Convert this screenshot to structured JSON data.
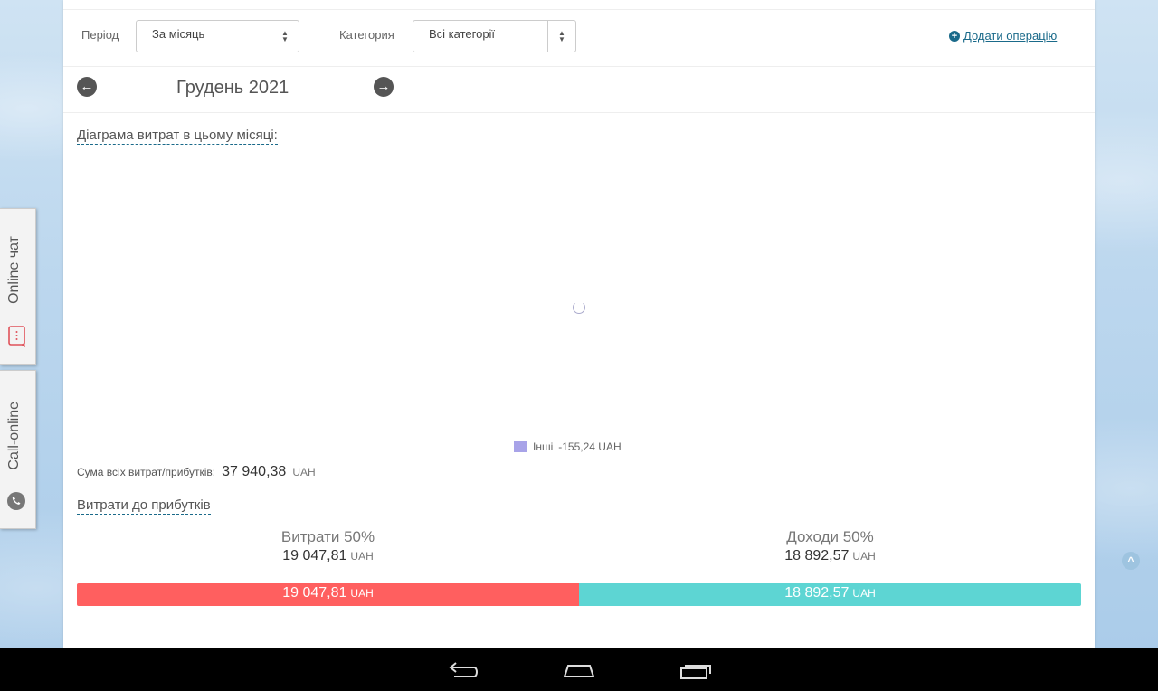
{
  "filters": {
    "period_label": "Період",
    "period_value": "За місяць",
    "category_label": "Категория",
    "category_value": "Всі категорії",
    "add_operation": "Додати операцію"
  },
  "month_nav": {
    "month": "Грудень 2021",
    "prev_icon": "arrow-left-circle-icon",
    "next_icon": "arrow-right-circle-icon"
  },
  "chart": {
    "link": "Діаграма витрат в цьому місяці:",
    "legend_label": "Інші",
    "legend_value": "-155,24 UAH",
    "legend_color": "#a8a3e8"
  },
  "total": {
    "label": "Сума всіх витрат/прибутків:",
    "value": "37 940,38",
    "currency": "UAH"
  },
  "ratio": {
    "link": "Витрати до прибутків",
    "expenses_title": "Витрати 50%",
    "expenses_value": "19 047,81",
    "expenses_currency": "UAH",
    "expenses_fraction": 0.5,
    "expenses_color": "#ff5f5f",
    "income_title": "Доходи 50%",
    "income_value": "18 892,57",
    "income_currency": "UAH",
    "income_fraction": 0.5,
    "income_color": "#5dd5d3"
  },
  "side_tabs": {
    "chat": "Online чат",
    "call": "Call-online"
  }
}
